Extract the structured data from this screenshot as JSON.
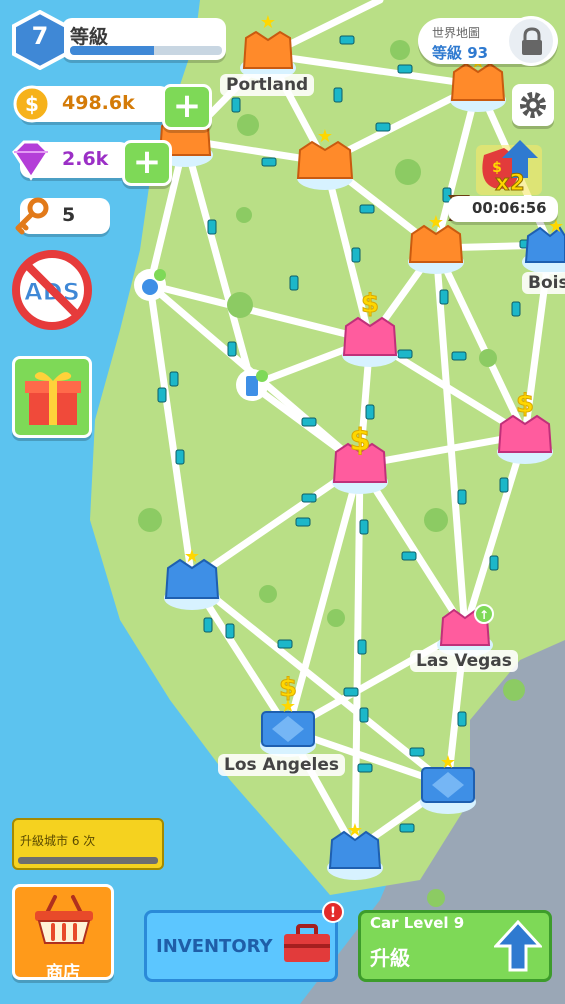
{
  "hud": {
    "level": {
      "number": "7",
      "label": "等級",
      "progress": 0.55
    },
    "coins": {
      "value": "498.6k",
      "plus": "+"
    },
    "gems": {
      "value": "2.6k",
      "plus": "+"
    },
    "keys": {
      "value": "5"
    },
    "ads_label": "ADS"
  },
  "world_map": {
    "title": "世界地圖",
    "level": "等級 93"
  },
  "boost": {
    "multiplier": "x2",
    "timer": "00:06:56"
  },
  "cities": {
    "portland": "Portland",
    "boise": "Bois",
    "las_vegas": "Las Vegas",
    "los_angeles": "Los Angeles"
  },
  "quest": {
    "text": "升級城市 6 次",
    "progress": 0.0
  },
  "bottom": {
    "shop_label": "商店",
    "inventory_label": "INVENTORY",
    "inventory_badge": "!",
    "car_level": "Car Level 9",
    "car_upgrade": "升級"
  },
  "colors": {
    "land": "#b9df86",
    "road": "#ffffff",
    "sea": "#5cc3ef",
    "city_orange": "#ff8a2a",
    "city_pink": "#ff5c9e",
    "city_blue": "#3e8fe6",
    "button_green": "#7ed957",
    "inventory_blue": "#5cc6ff"
  }
}
